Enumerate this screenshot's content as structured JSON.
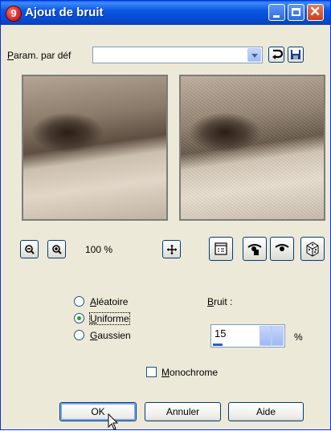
{
  "window": {
    "title": "Ajout de bruit",
    "app_icon_label": "9"
  },
  "preset": {
    "label_underlined": "P",
    "label_rest": "aram. par déf",
    "value": ""
  },
  "zoom": {
    "value": "100 %"
  },
  "distribution": {
    "options": [
      {
        "underlined": "A",
        "rest": "léatoire",
        "selected": false
      },
      {
        "underlined": "U",
        "rest": "niforme",
        "selected": true
      },
      {
        "underlined": "G",
        "rest": "aussien",
        "selected": false
      }
    ]
  },
  "noise": {
    "label_underlined": "B",
    "label_rest": "ruit :",
    "value": "15",
    "unit": "%"
  },
  "monochrome": {
    "label_underlined": "M",
    "label_rest": "onochrome",
    "checked": false
  },
  "buttons": {
    "ok": "OK",
    "cancel": "Annuler",
    "help": "Aide"
  },
  "colors": {
    "titlebar": "#0b58e3",
    "dialog_bg": "#ece9d8",
    "radio_dot": "#21a121"
  }
}
